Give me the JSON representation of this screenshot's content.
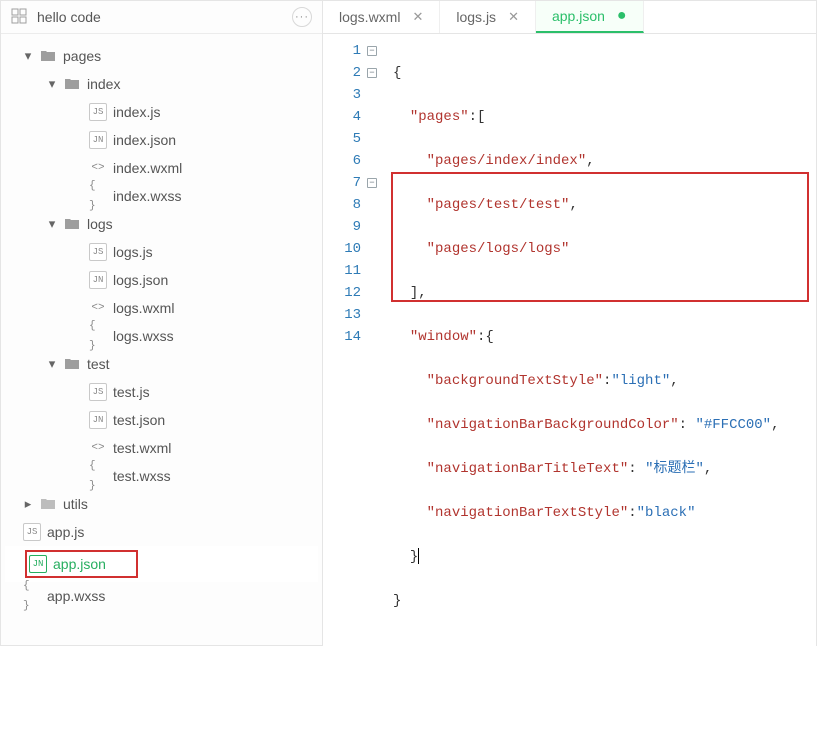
{
  "project": {
    "name": "hello code"
  },
  "tree": {
    "pages": {
      "label": "pages",
      "index": {
        "label": "index",
        "js": "index.js",
        "json": "index.json",
        "wxml": "index.wxml",
        "wxss": "index.wxss"
      },
      "logs": {
        "label": "logs",
        "js": "logs.js",
        "json": "logs.json",
        "wxml": "logs.wxml",
        "wxss": "logs.wxss"
      },
      "test": {
        "label": "test",
        "js": "test.js",
        "json": "test.json",
        "wxml": "test.wxml",
        "wxss": "test.wxss"
      }
    },
    "utils": {
      "label": "utils"
    },
    "appjs": "app.js",
    "appjson": "app.json",
    "appwxss": "app.wxss"
  },
  "tabs": {
    "t0": {
      "label": "logs.wxml"
    },
    "t1": {
      "label": "logs.js"
    },
    "t2": {
      "label": "app.json"
    }
  },
  "code": {
    "l1": "{",
    "l2_k": "\"pages\"",
    "l2_p": ":[",
    "l3": "\"pages/index/index\"",
    "l3_p": ",",
    "l4": "\"pages/test/test\"",
    "l4_p": ",",
    "l5": "\"pages/logs/logs\"",
    "l6": "],",
    "l7_k": "\"window\"",
    "l7_p": ":{",
    "l8_k": "\"backgroundTextStyle\"",
    "l8_v": "\"light\"",
    "l8_p": ",",
    "l9_k": "\"navigationBarBackgroundColor\"",
    "l9_v": "\"#FFCC00\"",
    "l9_p": ",",
    "l10_k": "\"navigationBarTitleText\"",
    "l10_v": "\"标题栏\"",
    "l10_p": ",",
    "l11_k": "\"navigationBarTextStyle\"",
    "l11_v": "\"black\"",
    "l12": "}",
    "l13": "}"
  },
  "linenums": {
    "n1": "1",
    "n2": "2",
    "n3": "3",
    "n4": "4",
    "n5": "5",
    "n6": "6",
    "n7": "7",
    "n8": "8",
    "n9": "9",
    "n10": "10",
    "n11": "11",
    "n12": "12",
    "n13": "13",
    "n14": "14"
  }
}
